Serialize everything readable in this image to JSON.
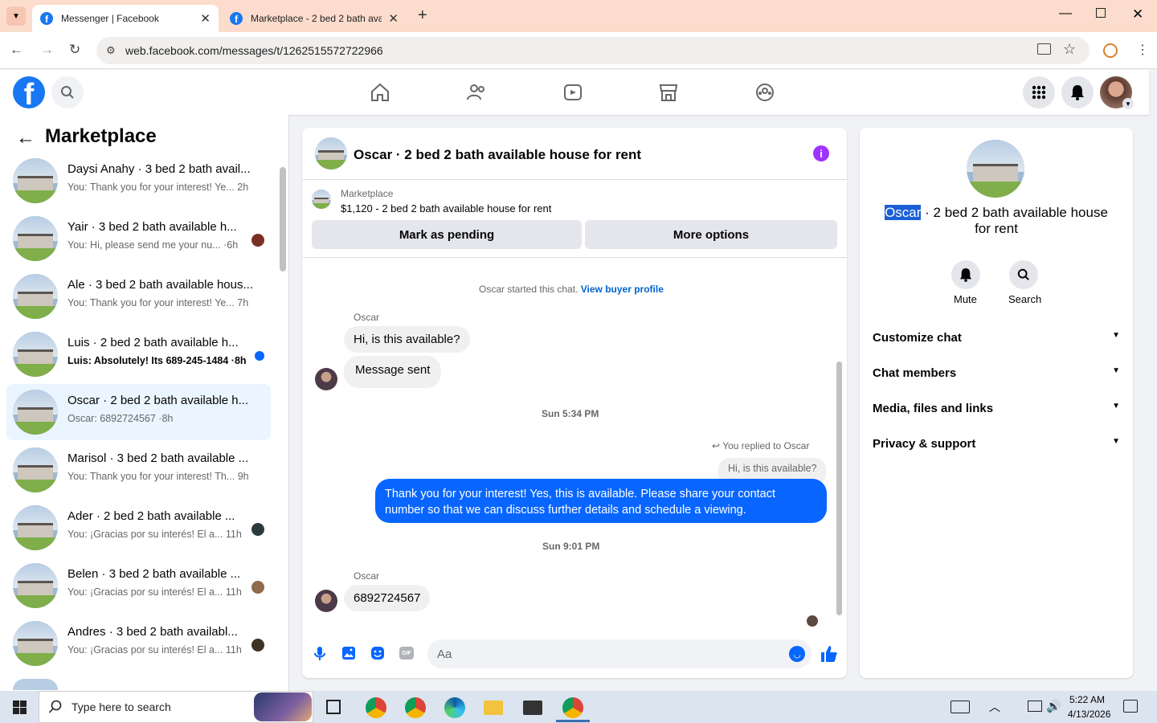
{
  "browser": {
    "tabs": [
      {
        "title": "Messenger | Facebook",
        "active": true
      },
      {
        "title": "Marketplace - 2 bed 2 bath avai",
        "active": false
      }
    ],
    "url": "web.facebook.com/messages/t/1262515572722966",
    "new_tab": "+"
  },
  "header": {
    "logo": "f",
    "nav_icons": [
      "home-icon",
      "friends-icon",
      "video-icon",
      "marketplace-icon",
      "groups-icon"
    ],
    "right_icons": [
      "menu-grid-icon",
      "bell-icon",
      "profile-avatar"
    ]
  },
  "left": {
    "title": "Marketplace",
    "conversations": [
      {
        "name": "Daysi Anahy · 3 bed 2 bath avail...",
        "preview": "You: Thank you for your interest! Ye...",
        "time": "2h",
        "unread": false
      },
      {
        "name": "Yair · 3 bed 2 bath available h...",
        "preview": "You: Hi, please send me your nu...",
        "time": "·6h",
        "unread": false
      },
      {
        "name": "Ale · 3 bed 2 bath available hous...",
        "preview": "You: Thank you for your interest! Ye...",
        "time": "7h",
        "unread": false
      },
      {
        "name": "Luis · 2 bed 2 bath available h...",
        "preview": "Luis: Absolutely! Its 689-245-1484 ·",
        "time": "8h",
        "unread": true
      },
      {
        "name": "Oscar · 2 bed 2 bath available h...",
        "preview": "Oscar: 6892724567 ·",
        "time": "8h",
        "unread": false,
        "selected": true
      },
      {
        "name": "Marisol · 3 bed 2 bath available ...",
        "preview": "You: Thank you for your interest! Th...",
        "time": "9h",
        "unread": false
      },
      {
        "name": "Ader · 2 bed 2 bath available ...",
        "preview": "You: ¡Gracias por su interés! El a...",
        "time": "11h",
        "unread": false
      },
      {
        "name": "Belen · 3 bed 2 bath available ...",
        "preview": "You: ¡Gracias por su interés! El a...",
        "time": "11h",
        "unread": false
      },
      {
        "name": "Andres · 3 bed 2 bath availabl...",
        "preview": "You: ¡Gracias por su interés! El a...",
        "time": "11h",
        "unread": false
      }
    ]
  },
  "chat": {
    "title": "Oscar · 2 bed 2 bath available house for rent",
    "listing_source": "Marketplace",
    "listing": "$1,120 - 2 bed 2 bath available house for rent",
    "mark_pending": "Mark as pending",
    "more_options": "More options",
    "started": "Oscar started this chat.",
    "view_profile": "View buyer profile",
    "sender1": "Oscar",
    "msg1": "Hi, is this available?",
    "msg2": "Message sent",
    "ts1": "Sun 5:34 PM",
    "replied": "You replied to Oscar",
    "quoted": "Hi, is this available?",
    "reply": "Thank you for your interest! Yes, this is available. Please share your contact number so that we can discuss further details and schedule a viewing.",
    "ts2": "Sun 9:01 PM",
    "sender2": "Oscar",
    "msg3": "6892724567",
    "composer_placeholder": "Aa",
    "gif": "GIF"
  },
  "right": {
    "title_highlight": "Oscar",
    "title_rest": " · 2 bed 2 bath available house for rent",
    "mute": "Mute",
    "search": "Search",
    "sections": [
      "Customize chat",
      "Chat members",
      "Media, files and links",
      "Privacy & support"
    ]
  },
  "taskbar": {
    "search_placeholder": "Type here to search",
    "time": "5:22 AM",
    "date": "4/13/2026"
  },
  "colors": {
    "accent": "#0866ff",
    "fb_blue": "#1877f2",
    "tabbar": "#fcdccc"
  }
}
